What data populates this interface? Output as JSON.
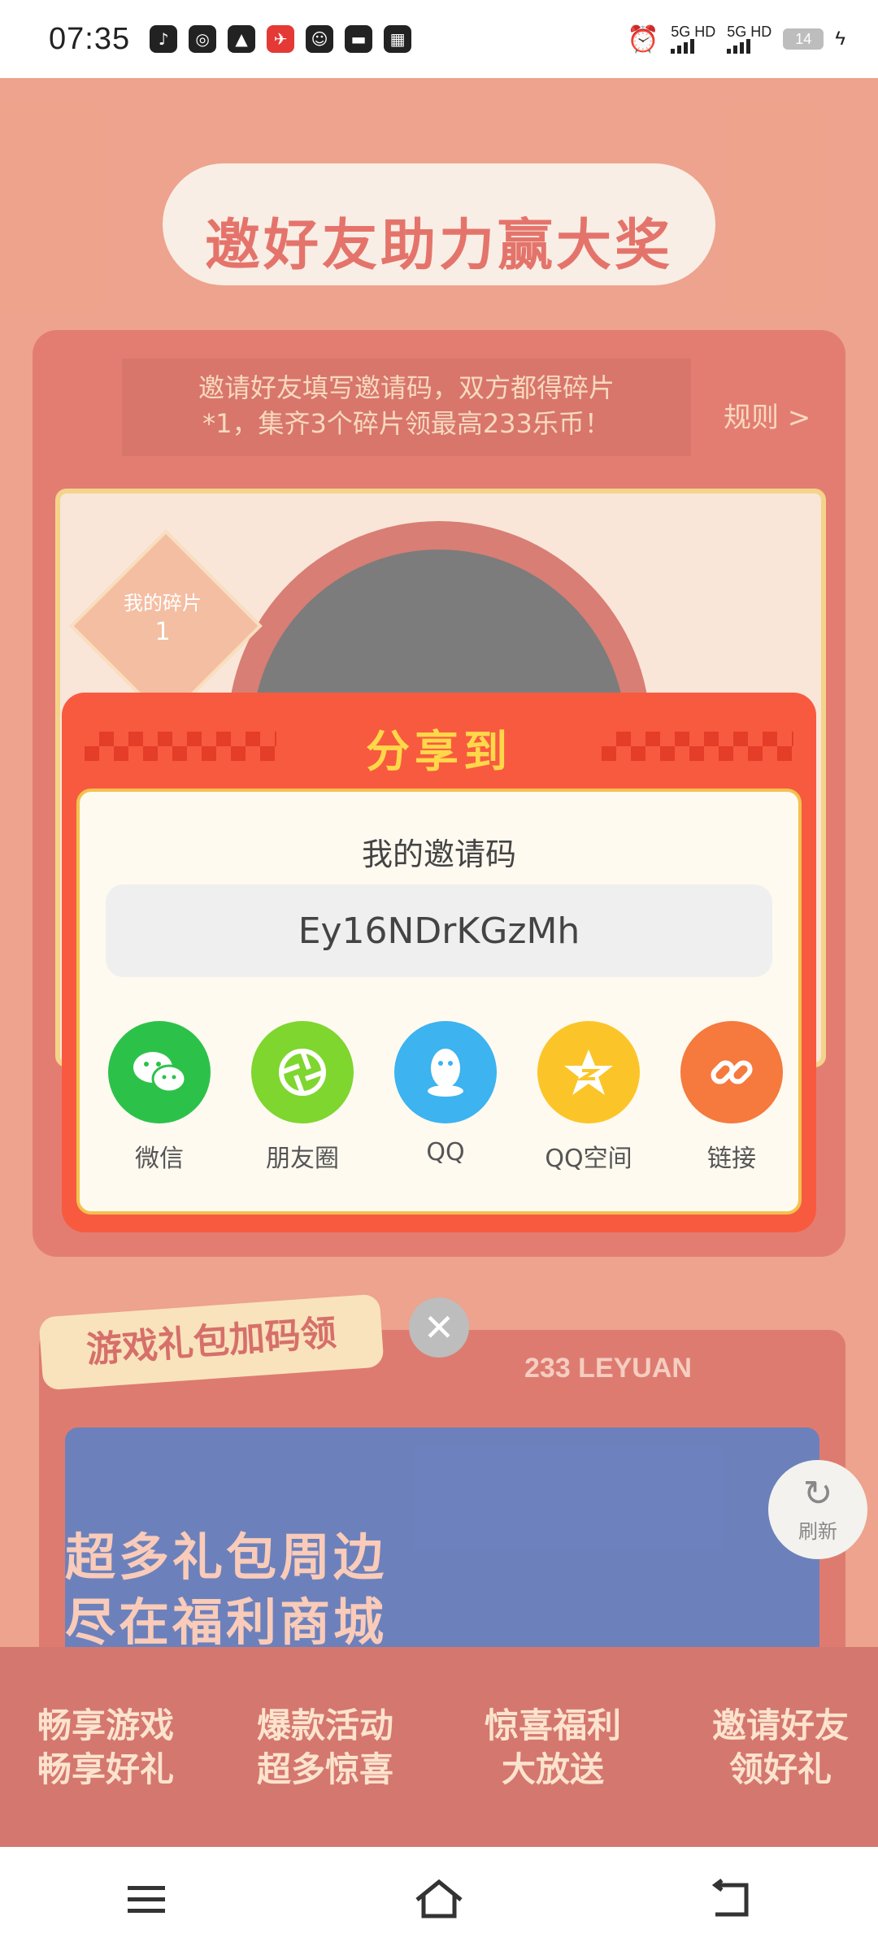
{
  "status_bar": {
    "time": "07:35",
    "app_icons": [
      "douyin-icon",
      "browser-icon",
      "map-icon",
      "ctrip-icon",
      "qq-icon",
      "inbox-icon",
      "gallery-icon"
    ],
    "app_icon_badge": "ctrip",
    "signal_1": "5G HD",
    "signal_2": "5G HD",
    "battery": "14"
  },
  "background": {
    "page_title": "邀好友助力赢大奖",
    "invite_text_line1": "邀请好友填写邀请码，双方都得碎片",
    "invite_text_line2": "*1，集齐3个碎片领最高233乐币！",
    "rules_link": "规则 >",
    "my_fragments_label": "我的碎片",
    "my_fragments_count": "1",
    "gift_section_title": "游戏礼包加码领",
    "gift_section_subtitle": "233 LEYUAN",
    "gift_banner_line1": "超多礼包周边",
    "gift_banner_line2": "尽在福利商城",
    "refresh_label": "刷新",
    "strip_items": [
      {
        "line1": "畅享游戏",
        "line2": "畅享好礼"
      },
      {
        "line1": "爆款活动",
        "line2": "超多惊喜"
      },
      {
        "line1": "惊喜福利",
        "line2": "大放送"
      },
      {
        "line1": "邀请好友",
        "line2": "领好礼"
      }
    ]
  },
  "share_modal": {
    "title": "分享到",
    "code_label": "我的邀请码",
    "invite_code": "Ey16NDrKGzMh",
    "targets": [
      {
        "label": "微信",
        "icon": "wechat-icon",
        "color": "#2cc24a"
      },
      {
        "label": "朋友圈",
        "icon": "moments-icon",
        "color": "#7ed62f"
      },
      {
        "label": "QQ",
        "icon": "qq-icon",
        "color": "#3db3f0"
      },
      {
        "label": "QQ空间",
        "icon": "qzone-icon",
        "color": "#fbc52a"
      },
      {
        "label": "链接",
        "icon": "link-icon",
        "color": "#f6793d"
      }
    ]
  },
  "colors": {
    "modal_accent": "#f85a40",
    "modal_title": "#ffd84a"
  }
}
